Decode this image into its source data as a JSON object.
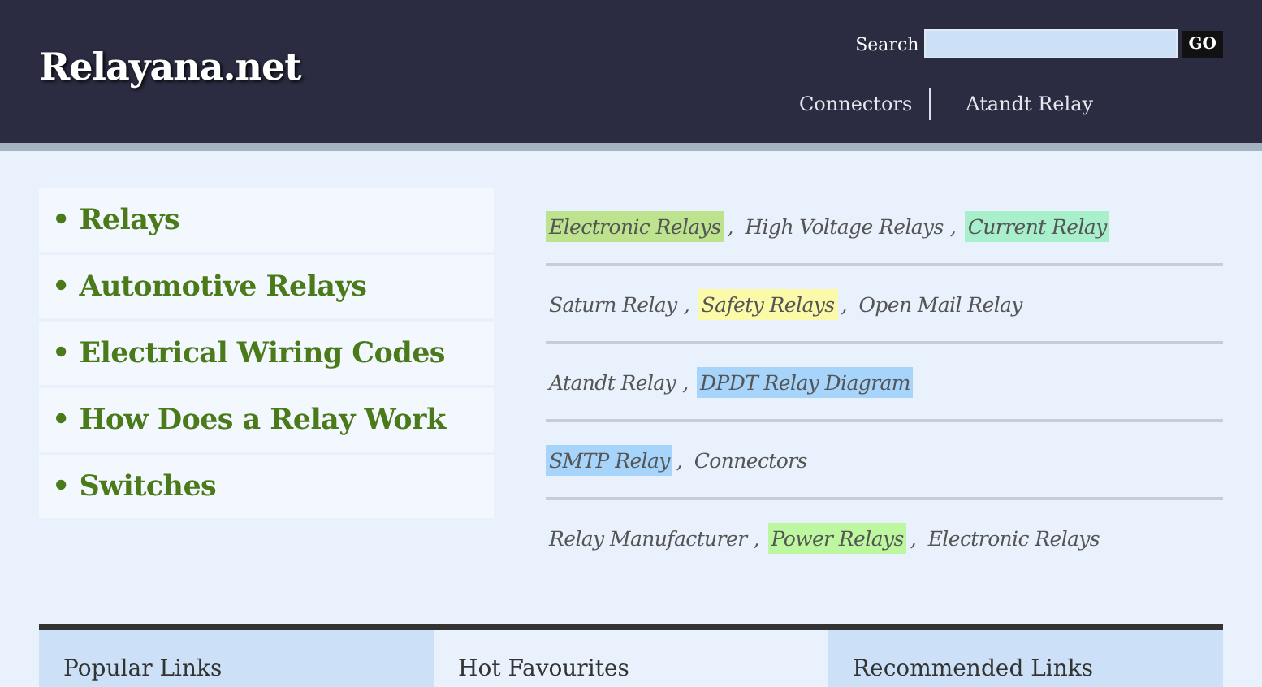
{
  "header": {
    "logo": "Relayana.net",
    "search": {
      "label": "Search",
      "button": "GO"
    },
    "nav": [
      "Connectors",
      "Atandt Relay"
    ]
  },
  "menu": [
    "Relays",
    "Automotive Relays",
    "Electrical Wiring Codes",
    "How Does a Relay Work",
    "Switches"
  ],
  "bullet": "•",
  "link_rows": [
    [
      {
        "text": "Electronic Relays",
        "color": "#bde38f",
        "separator": ","
      },
      {
        "text": "High Voltage Relays",
        "separator": ","
      },
      {
        "text": "Current Relay",
        "color": "#a8f0cc"
      }
    ],
    [
      {
        "text": "Saturn Relay",
        "separator": ","
      },
      {
        "text": "Safety Relays",
        "color": "#fafaa8",
        "separator": ","
      },
      {
        "text": "Open Mail Relay"
      }
    ],
    [
      {
        "text": "Atandt Relay",
        "separator": ","
      },
      {
        "text": "DPDT Relay Diagram",
        "color": "#a6d4fa"
      }
    ],
    [
      {
        "text": "SMTP Relay",
        "color": "#a6d4fa",
        "separator": ","
      },
      {
        "text": "Connectors"
      }
    ],
    [
      {
        "text": "Relay Manufacturer",
        "separator": ","
      },
      {
        "text": "Power Relays",
        "color": "#bdf7a0",
        "separator": ","
      },
      {
        "text": "Electronic Relays"
      }
    ]
  ],
  "footer": [
    {
      "title": "Popular Links",
      "selected": false
    },
    {
      "title": "Hot Favourites",
      "selected": true
    },
    {
      "title": "Recommended Links",
      "selected": false
    }
  ]
}
